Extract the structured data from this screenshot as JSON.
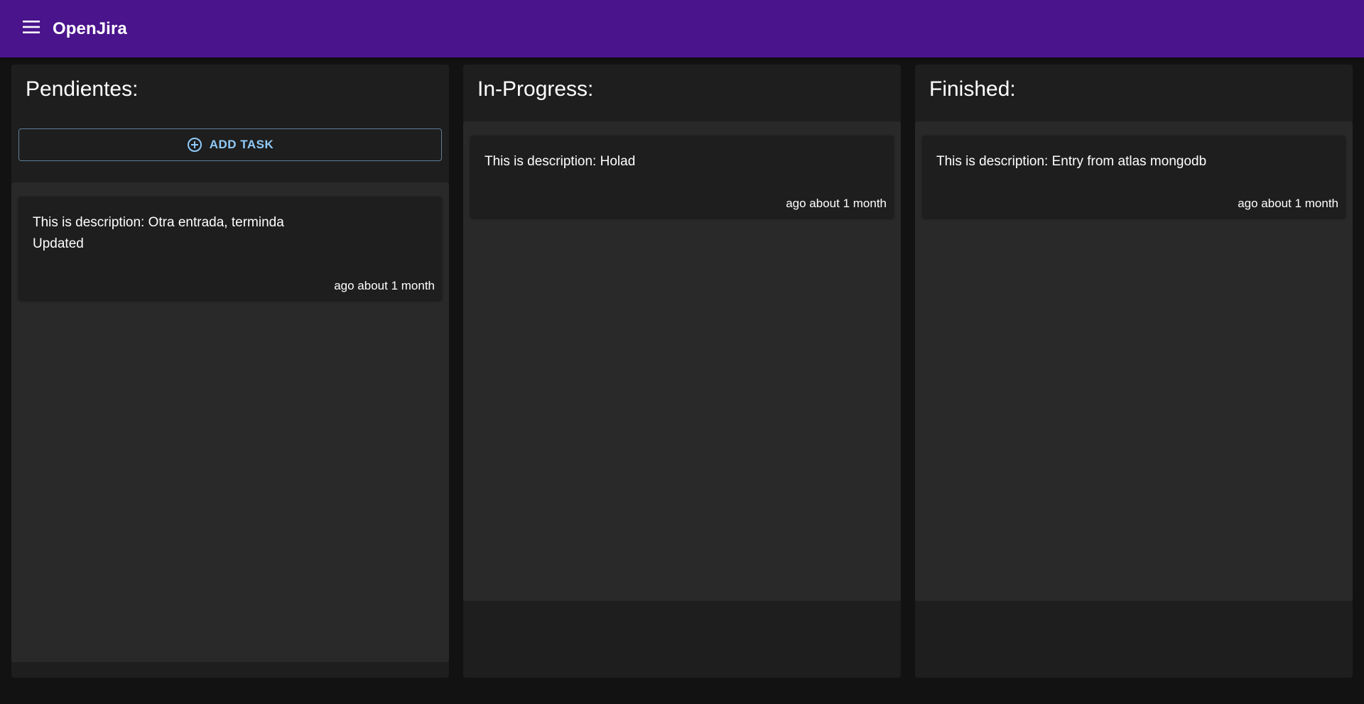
{
  "app": {
    "title": "OpenJira",
    "accent": "#4a148c"
  },
  "columns": [
    {
      "header": "Pendientes:",
      "add_button": {
        "label": "ADD TASK",
        "icon": "add-circle-icon"
      },
      "entries": [
        {
          "description": "This is description: Otra entrada, terminda\nUpdated",
          "time": "ago about 1 month"
        }
      ]
    },
    {
      "header": "In-Progress:",
      "entries": [
        {
          "description": "This is description: Holad",
          "time": "ago about 1 month"
        }
      ]
    },
    {
      "header": "Finished:",
      "entries": [
        {
          "description": "This is description: Entry from atlas mongodb",
          "time": "ago about 1 month"
        }
      ]
    }
  ]
}
